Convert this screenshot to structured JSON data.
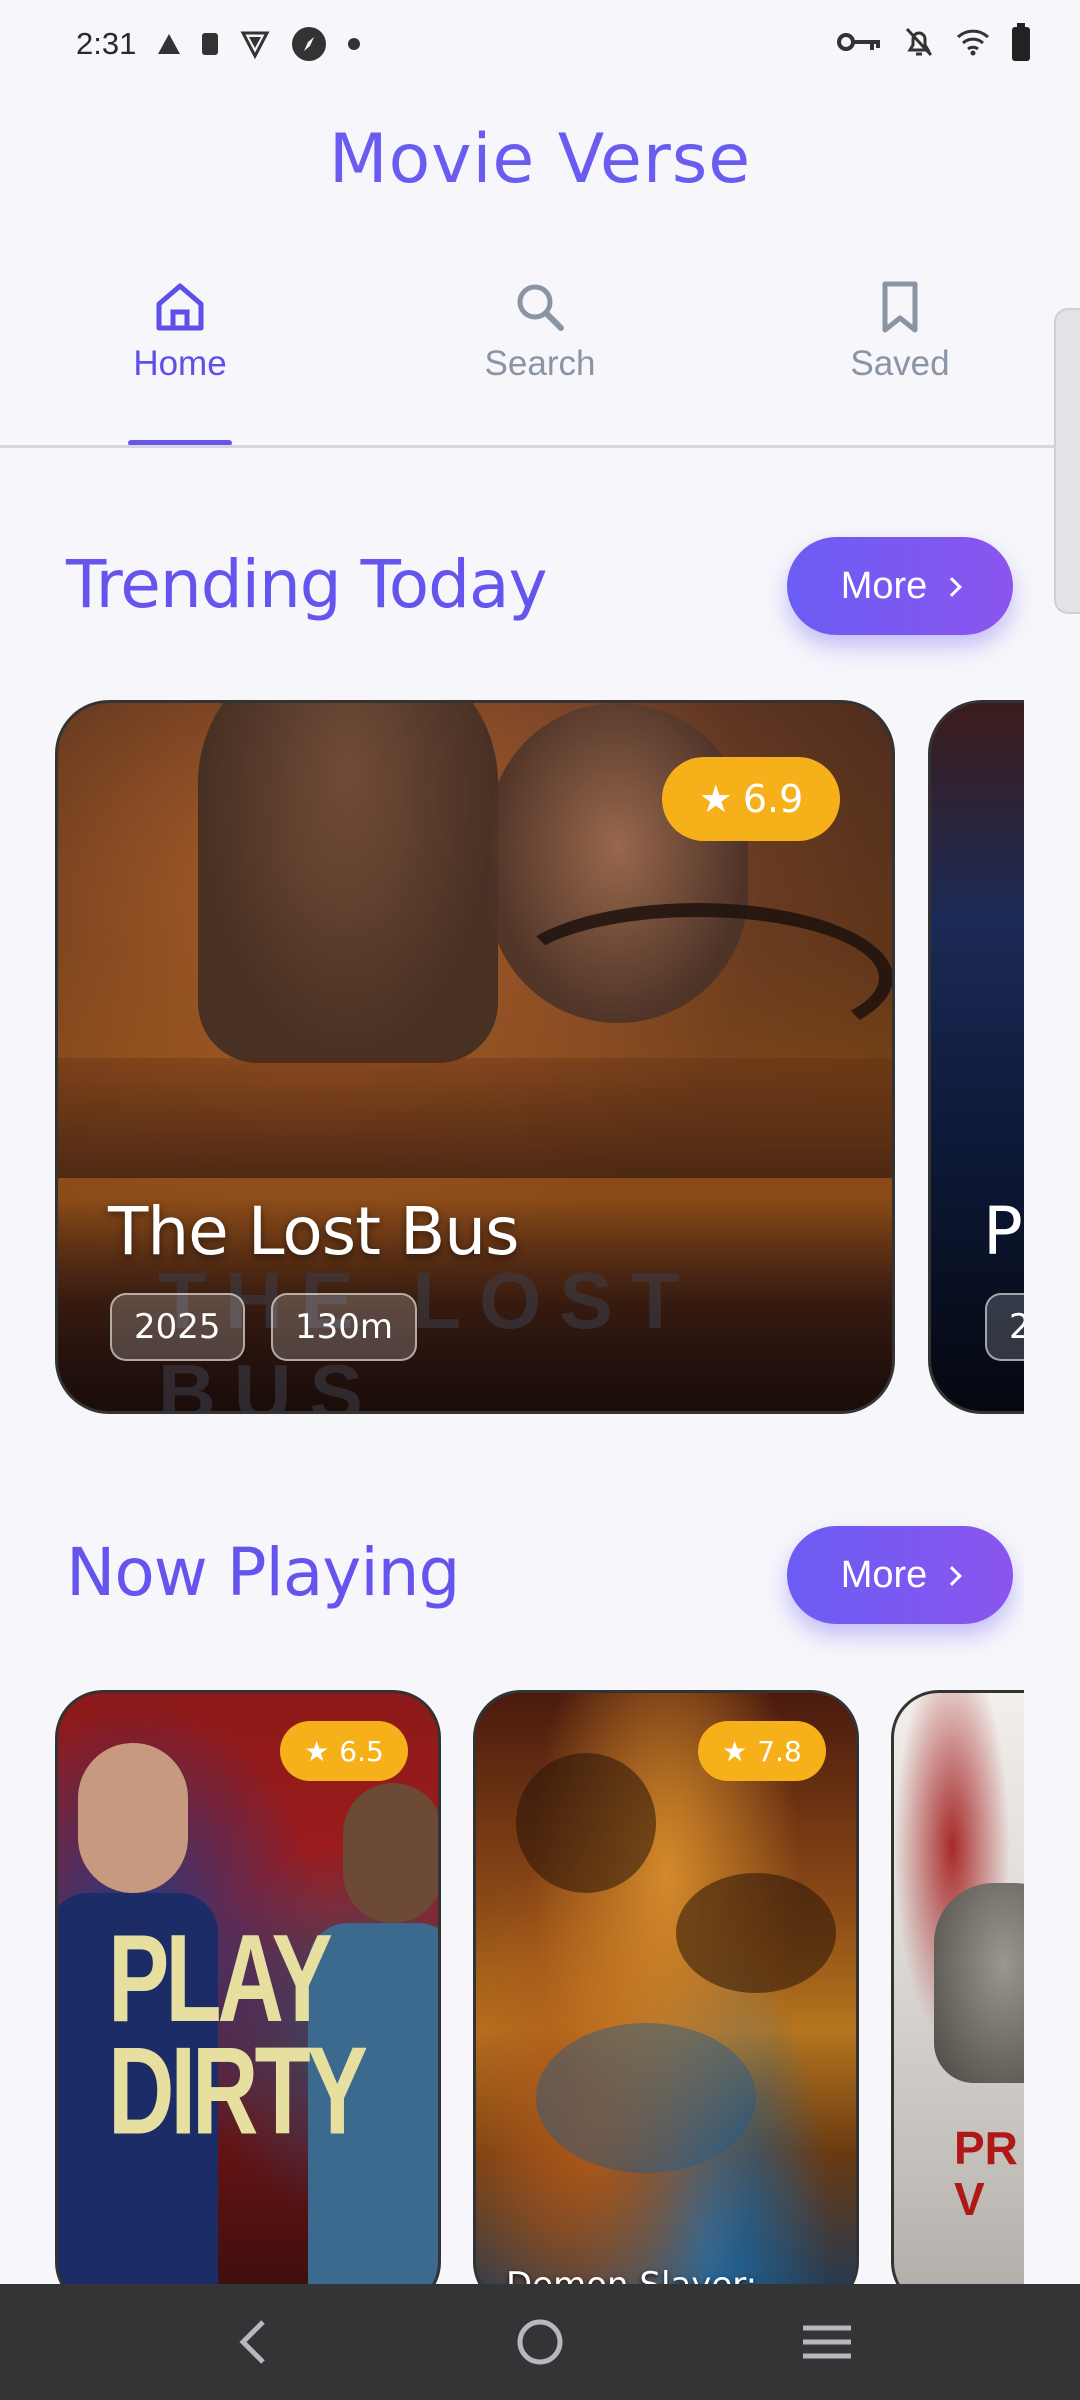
{
  "status_bar": {
    "time": "2:31"
  },
  "app": {
    "title": "Movie Verse"
  },
  "tabs": [
    {
      "label": "Home",
      "icon": "home-icon",
      "active": true
    },
    {
      "label": "Search",
      "icon": "search-icon",
      "active": false
    },
    {
      "label": "Saved",
      "icon": "bookmark-icon",
      "active": false
    }
  ],
  "trending": {
    "title": "Trending Today",
    "more_label": "More",
    "cards": [
      {
        "title": "The Lost Bus",
        "year": "2025",
        "runtime": "130m",
        "rating": "6.9",
        "poster_text": "THE LOST BUS"
      },
      {
        "title": "P",
        "year": "2"
      }
    ]
  },
  "now_playing": {
    "title": "Now Playing",
    "more_label": "More",
    "cards": [
      {
        "poster_text": "PLAY DIRTY",
        "rating": "6.5"
      },
      {
        "caption": "Demon Slayer:",
        "rating": "7.8"
      },
      {
        "poster_text": "PR\nV"
      }
    ]
  },
  "colors": {
    "accent": "#6a5cf0",
    "rating": "#f6b01a",
    "background": "#f6f6fb"
  }
}
